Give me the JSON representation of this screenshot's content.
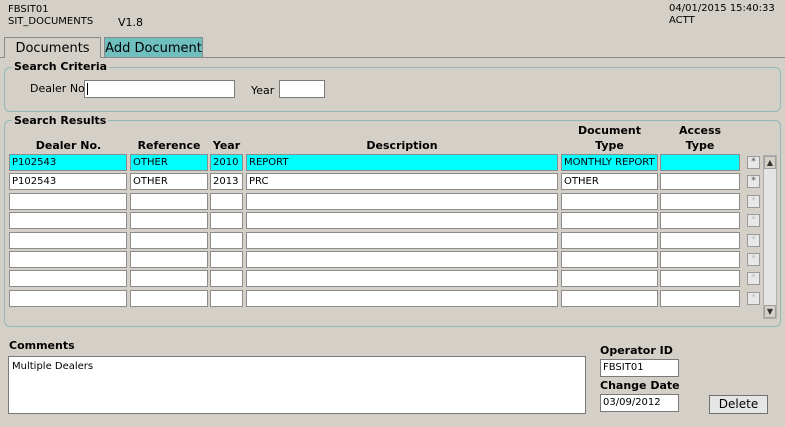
{
  "header": {
    "form_id": "FBSIT01",
    "form_name": "SIT_DOCUMENTS",
    "version": "V1.8",
    "datetime": "04/01/2015 15:40:33",
    "env": "ACTT"
  },
  "tabs": [
    {
      "label": "Documents",
      "active": true
    },
    {
      "label": "Add Document",
      "active": false
    }
  ],
  "search_criteria": {
    "title": "Search Criteria",
    "dealer_label": "Dealer No.",
    "dealer_value": "",
    "year_label": "Year",
    "year_value": ""
  },
  "results": {
    "title": "Search Results",
    "columns": {
      "dealer": "Dealer No.",
      "reference": "Reference",
      "year": "Year",
      "description": "Description",
      "doc_type_1": "Document",
      "doc_type_2": "Type",
      "access_type_1": "Access",
      "access_type_2": "Type"
    },
    "rows": [
      {
        "dealer": "P102543",
        "reference": "OTHER",
        "year": "2010",
        "description": "REPORT",
        "doc_type": "MONTHLY REPORT",
        "access_type": ""
      },
      {
        "dealer": "P102543",
        "reference": "OTHER",
        "year": "2013",
        "description": "PRC",
        "doc_type": "OTHER",
        "access_type": ""
      },
      {
        "dealer": "",
        "reference": "",
        "year": "",
        "description": "",
        "doc_type": "",
        "access_type": ""
      },
      {
        "dealer": "",
        "reference": "",
        "year": "",
        "description": "",
        "doc_type": "",
        "access_type": ""
      },
      {
        "dealer": "",
        "reference": "",
        "year": "",
        "description": "",
        "doc_type": "",
        "access_type": ""
      },
      {
        "dealer": "",
        "reference": "",
        "year": "",
        "description": "",
        "doc_type": "",
        "access_type": ""
      },
      {
        "dealer": "",
        "reference": "",
        "year": "",
        "description": "",
        "doc_type": "",
        "access_type": ""
      },
      {
        "dealer": "",
        "reference": "",
        "year": "",
        "description": "",
        "doc_type": "",
        "access_type": ""
      }
    ],
    "row_button_glyph": "*"
  },
  "comments": {
    "label": "Comments",
    "value": "Multiple Dealers"
  },
  "operator": {
    "label": "Operator ID",
    "value": "FBSIT01"
  },
  "change_date": {
    "label": "Change Date",
    "value": "03/09/2012"
  },
  "delete_label": "Delete",
  "colors": {
    "background": "#d4d0c8",
    "selected_row": "#00ffff",
    "inactive_tab": "#6fbfbf"
  }
}
